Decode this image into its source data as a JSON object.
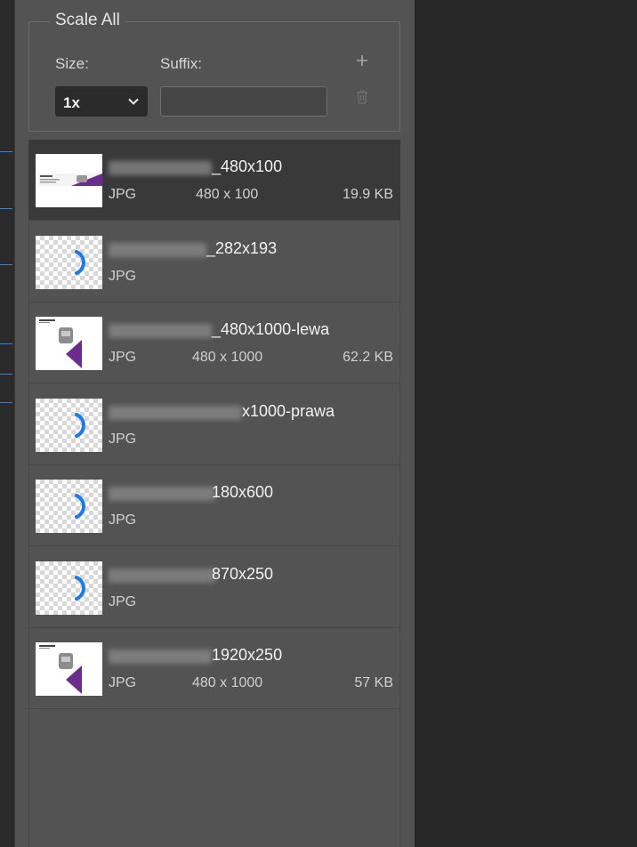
{
  "scale_all": {
    "title": "Scale All",
    "size_label": "Size:",
    "suffix_label": "Suffix:",
    "size_value": "1x",
    "suffix_value": "",
    "add_icon": "plus-icon",
    "delete_icon": "trash-icon"
  },
  "colors": {
    "spinner": "#1e7be0",
    "purple": "#6b2d8c",
    "guide": "#3b7fd9"
  },
  "assets": [
    {
      "name_suffix": "_480x100",
      "format": "JPG",
      "dimensions": "480 x 100",
      "size": "19.9 KB",
      "thumb": "banner",
      "selected": true
    },
    {
      "name_suffix": "_282x193",
      "format": "JPG",
      "dimensions": "",
      "size": "",
      "thumb": "loading",
      "selected": false
    },
    {
      "name_suffix": "_480x1000-lewa",
      "format": "JPG",
      "dimensions": "480 x 1000",
      "size": "62.2 KB",
      "thumb": "product",
      "selected": false
    },
    {
      "name_suffix": "x1000-prawa",
      "format": "JPG",
      "dimensions": "",
      "size": "",
      "thumb": "loading",
      "selected": false
    },
    {
      "name_suffix": "180x600",
      "format": "JPG",
      "dimensions": "",
      "size": "",
      "thumb": "loading",
      "selected": false
    },
    {
      "name_suffix": "870x250",
      "format": "JPG",
      "dimensions": "",
      "size": "",
      "thumb": "loading",
      "selected": false
    },
    {
      "name_suffix": "1920x250",
      "format": "JPG",
      "dimensions": "480 x 1000",
      "size": "57 KB",
      "thumb": "product",
      "selected": false
    }
  ]
}
